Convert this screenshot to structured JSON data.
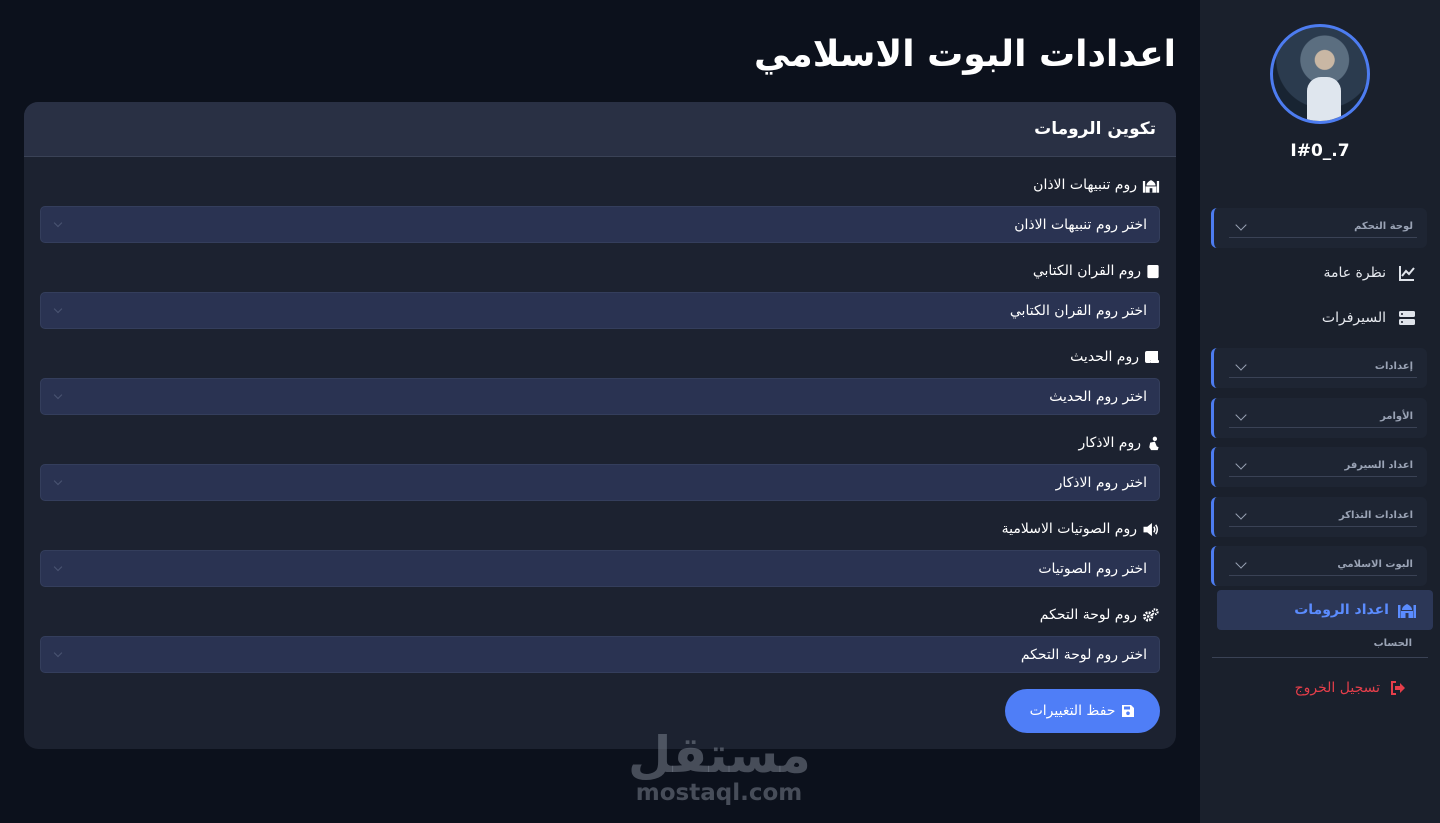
{
  "sidebar": {
    "username": "I#0_.7",
    "sections": [
      {
        "label": "لوحة التحكم"
      },
      {
        "label": "إعدادات"
      },
      {
        "label": "الأوامر"
      },
      {
        "label": "اعداد السيرفر"
      },
      {
        "label": "اعدادات التذاكر"
      },
      {
        "label": "البوت الاسلامي"
      }
    ],
    "links": [
      {
        "label": "نظرة عامة",
        "icon": "chart-line-icon"
      },
      {
        "label": "السيرفرات",
        "icon": "server-icon"
      }
    ],
    "active_link": {
      "label": "اعداد الرومات",
      "icon": "mosque-icon"
    },
    "account_label": "الحساب",
    "logout_label": "تسجيل الخروج",
    "accent_color": "#4d7cf0",
    "logout_color": "#e53e4a"
  },
  "main": {
    "title": "اعدادات البوت الاسلامي",
    "card_title": "تكوين الرومات",
    "fields": [
      {
        "label": "روم تنبيهات الاذان",
        "icon": "mosque-icon",
        "select_value": "اختر روم تنبيهات الاذان"
      },
      {
        "label": "روم القران الكتابي",
        "icon": "quran-icon",
        "select_value": "اختر روم القران الكتابي"
      },
      {
        "label": "روم الحديث",
        "icon": "scroll-icon",
        "select_value": "اختر روم الحديث"
      },
      {
        "label": "روم الاذكار",
        "icon": "praying-icon",
        "select_value": "اختر روم الاذكار"
      },
      {
        "label": "روم الصوتيات الاسلامية",
        "icon": "volume-icon",
        "select_value": "اختر روم الصوتيات"
      },
      {
        "label": "روم لوحة التحكم",
        "icon": "gears-icon",
        "select_value": "اختر روم لوحة التحكم"
      }
    ],
    "save_label": "حفظ التغييرات",
    "save_color": "#4f7ef7"
  },
  "watermark": {
    "logo_text": "مستقل",
    "url": "mostaql.com"
  }
}
